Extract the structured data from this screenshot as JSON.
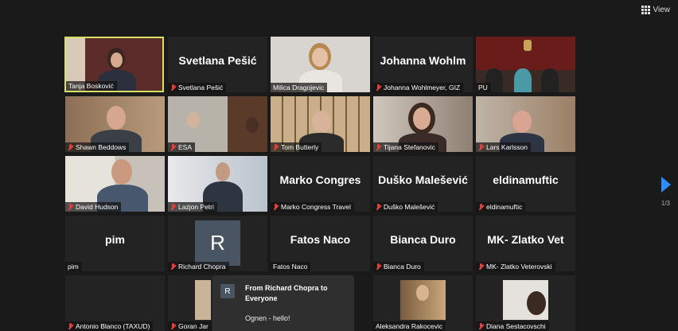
{
  "toolbar": {
    "view_label": "View"
  },
  "tiles": [
    "Tanja Bosković",
    "Svetlana Pešić",
    "Milica Dragojevic",
    "Johanna Wohlmeyer, GIZ",
    "PU",
    "Shawn Beddows",
    "ESA",
    "Tom Butterly",
    "Tijana Stefanovic",
    "Lars Karlsson",
    "David Hudson",
    "Lazjon Petri",
    "Marko Congress Travel",
    "Duško Malešević",
    "eldinamuftic",
    "pim",
    "Richard Chopra",
    "Fatos Naco",
    "Bianca Duro",
    "MK- Zlatko Veterovski",
    "Antonio Blanco (TAXUD)",
    "Goran Jar",
    "Aleksandra Rakocevic",
    "Diana Sestacovschi"
  ],
  "bignames": {
    "svetlana": "Svetlana Pešić",
    "johanna": "Johanna  Wohlm",
    "marko": "Marko  Congres",
    "dusko": "Duško Malešević",
    "eldin": "eldinamuftic",
    "pim": "pim",
    "fatos": "Fatos Naco",
    "bianca": "Bianca Duro",
    "zlatko": "MK- Zlatko Vet"
  },
  "avatar_letter": "R",
  "chat": {
    "avatar_letter": "R",
    "from": "From Richard Chopra to Everyone",
    "message": "Ognen - hello!"
  },
  "pager": {
    "text": "1/3"
  },
  "colors": {
    "active_speaker_border": "#d6e065",
    "accent": "#2d8cff",
    "muted_mic": "#e0413b"
  }
}
